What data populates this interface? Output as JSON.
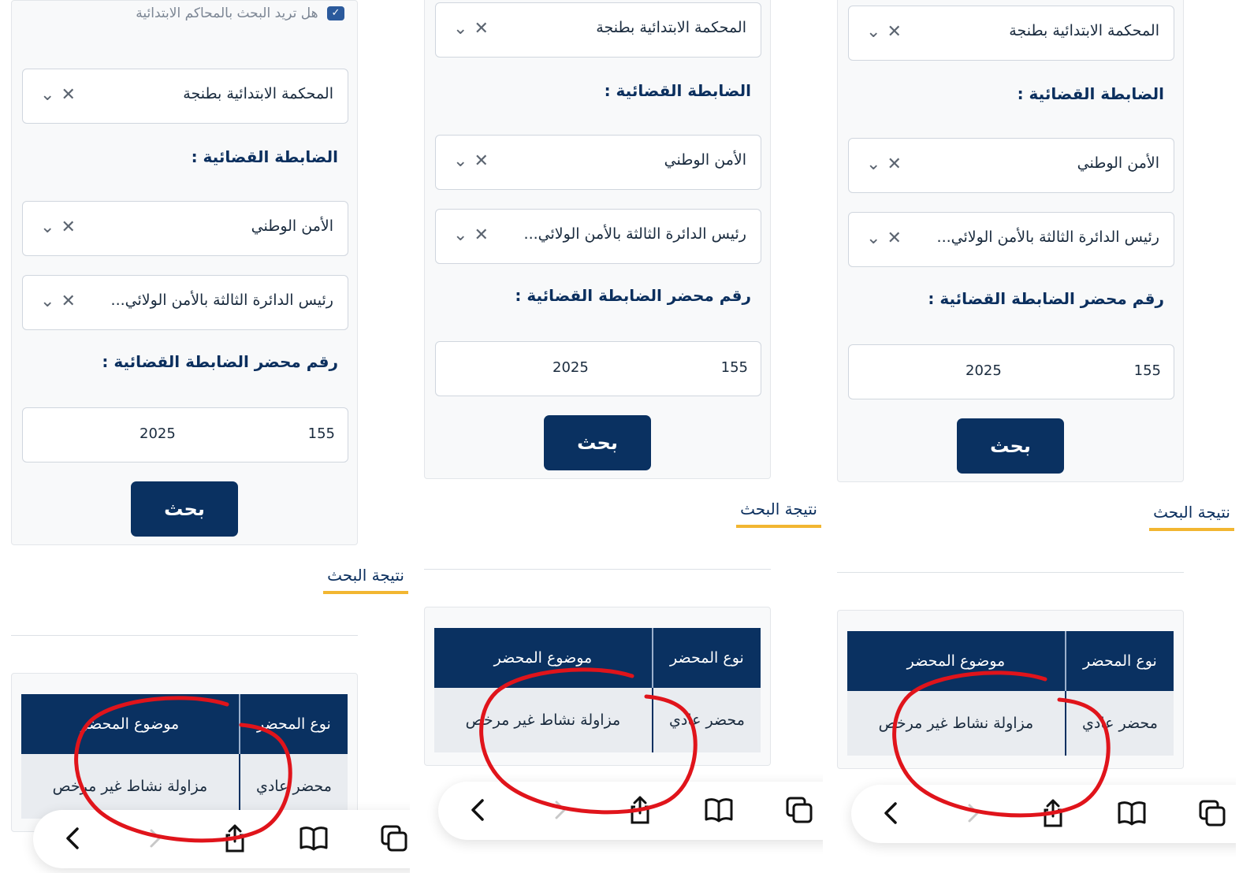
{
  "form": {
    "top_checkbox_label": "هل تريد البحث بالمحاكم الابتدائية",
    "court_value": "المحكمة الابتدائية بطنجة",
    "police_label": "الضابطة القضائية :",
    "police_value": "الأمن الوطني",
    "department_value": "رئيس الدائرة الثالثة بالأمن الولائي...",
    "report_label": "رقم محضر الضابطة القضائية :",
    "report_number": "155",
    "report_year": "2025",
    "search_button": "بحث"
  },
  "results": {
    "title": "نتيجة البحث",
    "headers": [
      "نوع المحضر",
      "موضوع المحضر"
    ],
    "row": [
      "محضر عادي",
      "مزاولة نشاط غير مرخص"
    ]
  },
  "icons": {
    "dropdown": "chevron-down-icon",
    "clear": "close-icon",
    "back": "chevron-left-icon",
    "forward": "chevron-right-icon",
    "share": "share-icon",
    "bookmarks": "book-icon",
    "tabs": "tabs-icon"
  },
  "colors": {
    "primary": "#0a3161",
    "accent": "#f2b631",
    "annotation": "#e0141b"
  }
}
